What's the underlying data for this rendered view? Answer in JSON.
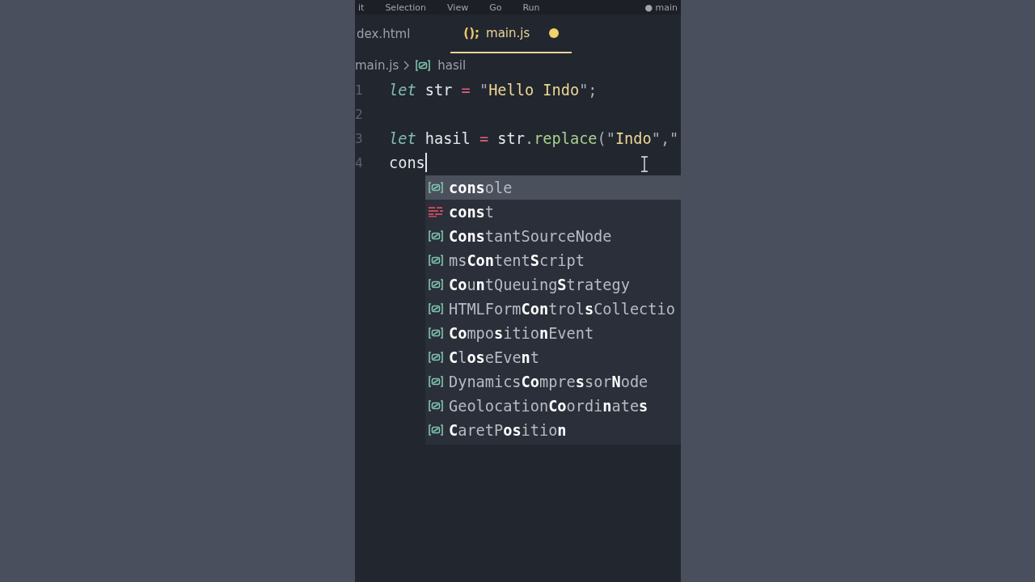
{
  "menu_bar": {
    "items": [
      "it",
      "Selection",
      "View",
      "Go",
      "Run"
    ],
    "title": "● main"
  },
  "tabs": [
    {
      "label": "dex.html",
      "selected": false,
      "modified": false
    },
    {
      "label": "main.js",
      "selected": true,
      "modified": true,
      "icon_text": "();"
    }
  ],
  "breadcrumb": [
    {
      "label": "main.js",
      "kind": "file"
    },
    {
      "label": "hasil",
      "kind": "variable"
    }
  ],
  "editor": {
    "lines": [
      {
        "number": "1",
        "cursor": false,
        "tokens": [
          {
            "text": "let",
            "kind": "keyword"
          },
          {
            "text": " str ",
            "kind": "plain"
          },
          {
            "text": "=",
            "kind": "operator"
          },
          {
            "text": " \"",
            "kind": "punct"
          },
          {
            "text": "Hello Indo",
            "kind": "string"
          },
          {
            "text": "\";",
            "kind": "punct"
          }
        ]
      },
      {
        "number": "2",
        "cursor": false
      },
      {
        "number": "3",
        "cursor": false,
        "tokens": [
          {
            "text": "let",
            "kind": "keyword"
          },
          {
            "text": " hasil ",
            "kind": "plain"
          },
          {
            "text": "=",
            "kind": "operator"
          },
          {
            "text": " str",
            "kind": "plain"
          },
          {
            "text": ".",
            "kind": "punct"
          },
          {
            "text": "replace",
            "kind": "method"
          },
          {
            "text": "(\"",
            "kind": "punct"
          },
          {
            "text": "Indo",
            "kind": "string"
          },
          {
            "text": "\",\"",
            "kind": "punct"
          }
        ]
      },
      {
        "number": "4",
        "cursor": true,
        "tokens": [
          {
            "text": "cons",
            "kind": "plain"
          }
        ]
      }
    ]
  },
  "suggestions": [
    {
      "label": "**cons**ole",
      "kind": "variable",
      "selected": true
    },
    {
      "label": "**cons**t",
      "kind": "keyword",
      "selected": false
    },
    {
      "label": "**Cons**tantSourceNode",
      "kind": "variable",
      "selected": false
    },
    {
      "label": "ms**Con**tent**S**cript",
      "kind": "variable",
      "selected": false
    },
    {
      "label": "**Co**u**n**tQueuing**S**trategy",
      "kind": "variable",
      "selected": false
    },
    {
      "label": "HTMLForm**Con**trol**s**Collectio",
      "kind": "variable",
      "selected": false
    },
    {
      "label": "**Co**mpo**s**itio**n**Event",
      "kind": "variable",
      "selected": false
    },
    {
      "label": "**C**l**os**eEve**n**t",
      "kind": "variable",
      "selected": false
    },
    {
      "label": "Dynamics**Co**mpre**s**sor**N**ode",
      "kind": "variable",
      "selected": false
    },
    {
      "label": "Geolocation**Co**ordi**n**ate**s**",
      "kind": "variable",
      "selected": false
    },
    {
      "label": "**C**aretP**os**itio**n**",
      "kind": "variable",
      "selected": false
    }
  ]
}
